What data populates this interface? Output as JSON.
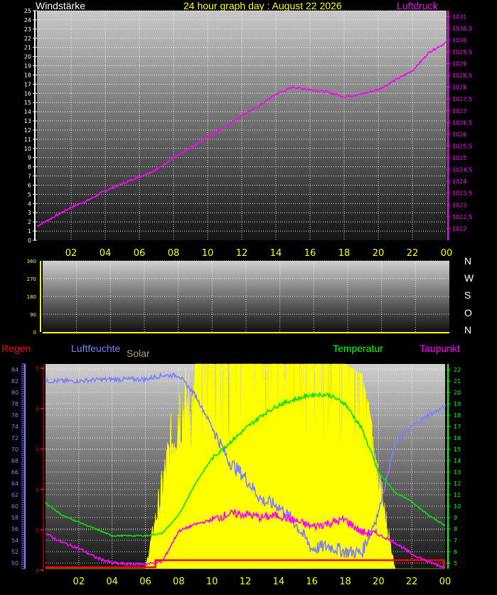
{
  "title": "24 hour graph day : August 22 2026",
  "colors": {
    "bg": "#000000",
    "pressure": "#ff00ff",
    "humidity": "#8080ff",
    "temperature": "#00e000",
    "dewpoint": "#ff00ff",
    "solar": "#ffff00",
    "rain": "#ff0000",
    "wind_axis": "#ffffff",
    "rain_axis": "#ff0000",
    "temp_axis": "#00ff00",
    "axis_text": "#ffff00"
  },
  "x_ticks": [
    "02",
    "04",
    "06",
    "08",
    "10",
    "12",
    "14",
    "16",
    "18",
    "20",
    "22",
    "00"
  ],
  "panel1": {
    "left_label": "Windstärke",
    "right_label": "Luftdruck",
    "left_ticks": [
      "0",
      "1",
      "2",
      "3",
      "4",
      "5",
      "6",
      "7",
      "8",
      "9",
      "10",
      "11",
      "12",
      "13",
      "14",
      "15",
      "16",
      "17",
      "18",
      "19",
      "20",
      "21",
      "22",
      "23",
      "24",
      "25"
    ],
    "right_ticks": [
      "1022",
      "1022,5",
      "1023",
      "1023,5",
      "1024",
      "1024,5",
      "1025",
      "1025,5",
      "1026",
      "1026,5",
      "1027",
      "1027,5",
      "1028",
      "1028,5",
      "1029",
      "1029,5",
      "1030",
      "1030,5",
      "1031"
    ]
  },
  "panel2": {
    "left_ticks": [
      "0",
      "90",
      "180",
      "270",
      "360"
    ],
    "compass": [
      "N",
      "W",
      "S",
      "O",
      "N"
    ]
  },
  "panel3": {
    "labels": {
      "rain": "Regen",
      "humidity": "Luftfeuchte",
      "solar": "Solar",
      "temperature": "Temperatur",
      "dewpoint": "Taupunkt"
    },
    "humidity_ticks": [
      "50",
      "52",
      "54",
      "56",
      "58",
      "60",
      "62",
      "64",
      "66",
      "68",
      "70",
      "72",
      "74",
      "76",
      "78",
      "80",
      "82",
      "84"
    ],
    "temp_ticks": [
      "5",
      "6",
      "7",
      "8",
      "9",
      "10",
      "11",
      "12",
      "13",
      "14",
      "15",
      "16",
      "17",
      "18",
      "19",
      "20",
      "21",
      "22"
    ],
    "rain_ticks": [
      "0",
      "1",
      "2",
      "3",
      "4",
      "5"
    ]
  },
  "chart_data": [
    {
      "type": "line",
      "title": "24 hour graph day : August 22 2026",
      "xlabel": "",
      "ylabel": "Windstärke",
      "ylim": [
        0,
        25
      ],
      "y2lim": [
        1021.5,
        1031.25
      ],
      "x": [
        0,
        1,
        2,
        3,
        4,
        5,
        6,
        7,
        8,
        9,
        10,
        11,
        12,
        13,
        14,
        15,
        16,
        17,
        18,
        19,
        20,
        21,
        22,
        23,
        24
      ],
      "series": [
        {
          "name": "Luftdruck",
          "axis": "right",
          "values": [
            1022.1,
            1022.5,
            1022.9,
            1023.2,
            1023.6,
            1023.9,
            1024.2,
            1024.5,
            1025.0,
            1025.4,
            1025.9,
            1026.3,
            1026.8,
            1027.2,
            1027.7,
            1028.0,
            1027.9,
            1027.8,
            1027.6,
            1027.7,
            1027.9,
            1028.3,
            1028.7,
            1029.5,
            1029.9
          ]
        }
      ]
    },
    {
      "type": "line",
      "ylabel": "",
      "ylim": [
        0,
        360
      ],
      "x": [
        0,
        24
      ],
      "series": []
    },
    {
      "type": "line",
      "ylim": [
        49,
        85
      ],
      "y2lim": [
        4.5,
        22.5
      ],
      "y3lim": [
        0,
        5
      ],
      "x": [
        0,
        1,
        2,
        3,
        4,
        5,
        6,
        7,
        8,
        9,
        10,
        11,
        12,
        13,
        14,
        15,
        16,
        17,
        18,
        19,
        20,
        21,
        22,
        23,
        24
      ],
      "series": [
        {
          "name": "Luftfeuchte",
          "axis": "humidity",
          "values": [
            82.0,
            82.0,
            82.0,
            82.2,
            82.3,
            82.3,
            82.3,
            83.0,
            83.0,
            79.5,
            74.0,
            68.0,
            65.0,
            61.0,
            60.0,
            57.0,
            52.5,
            53.0,
            52.0,
            51.8,
            59.0,
            71.0,
            74.0,
            76.0,
            77.5
          ]
        },
        {
          "name": "Temperatur",
          "axis": "temperature",
          "values": [
            10.3,
            9.2,
            8.6,
            8.0,
            7.4,
            7.4,
            7.4,
            7.6,
            9.2,
            12.0,
            14.2,
            15.5,
            16.8,
            18.0,
            18.9,
            19.4,
            19.8,
            19.8,
            19.0,
            16.8,
            13.0,
            11.2,
            10.4,
            9.2,
            8.3
          ]
        },
        {
          "name": "Taupunkt",
          "axis": "temperature",
          "values": [
            7.6,
            6.8,
            6.3,
            5.5,
            5.0,
            4.9,
            4.9,
            5.1,
            7.8,
            8.4,
            8.8,
            9.3,
            9.3,
            9.0,
            9.2,
            8.7,
            8.2,
            8.5,
            8.8,
            7.7,
            7.5,
            6.8,
            5.8,
            5.1,
            4.6
          ]
        },
        {
          "name": "Solar",
          "axis": "solar",
          "values": [
            0,
            0,
            0,
            0,
            0,
            0,
            0,
            0.5,
            1.0,
            1.0,
            1.0,
            1.0,
            1.0,
            1.0,
            1.0,
            1.0,
            1.0,
            1.0,
            1.0,
            0.95,
            0.55,
            0,
            0,
            0,
            0
          ]
        },
        {
          "name": "Regen",
          "axis": "rain",
          "values": [
            0.1,
            0.1,
            0.1,
            0.1,
            0.1,
            0.1,
            0.1,
            0.1,
            0.1,
            0.1,
            0.1,
            0.1,
            0.1,
            0.1,
            0.1,
            0.1,
            0.1,
            0.1,
            0.1,
            0.1,
            0.1,
            0.1,
            0.1,
            0.1,
            0.1
          ]
        }
      ]
    }
  ]
}
